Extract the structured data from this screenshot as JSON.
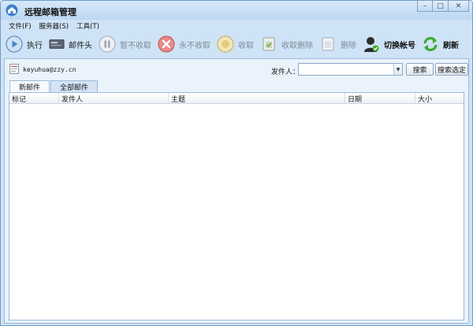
{
  "window": {
    "title": "远程邮箱管理"
  },
  "menu": [
    {
      "label": "文件(F)",
      "name": "menu-file"
    },
    {
      "label": "服务器(S)",
      "name": "menu-server"
    },
    {
      "label": "工具(T)",
      "name": "menu-tools"
    }
  ],
  "toolbar": {
    "execute": "执行",
    "mail_header": "邮件头",
    "pause_receive": "暂不收取",
    "never_receive": "永不收取",
    "receive": "收取",
    "receive_delete": "收取删除",
    "delete": "删除",
    "switch_account": "切换帐号",
    "refresh": "刷新"
  },
  "account": {
    "email": "keyuhua@zzy.cn"
  },
  "filter": {
    "sender_label": "发件人：",
    "sender_value": "",
    "search_button": "搜索",
    "search_selected_button": "搜索选定"
  },
  "tabs": [
    {
      "label": "新邮件",
      "active": true
    },
    {
      "label": "全部邮件",
      "active": false
    }
  ],
  "table": {
    "columns": [
      "标记",
      "发件人",
      "主题",
      "日期",
      "大小"
    ],
    "rows": []
  },
  "colors": {
    "accent_blue": "#4f8fd6",
    "disabled_text": "#7e8a96",
    "refresh_green": "#3caa2a"
  }
}
